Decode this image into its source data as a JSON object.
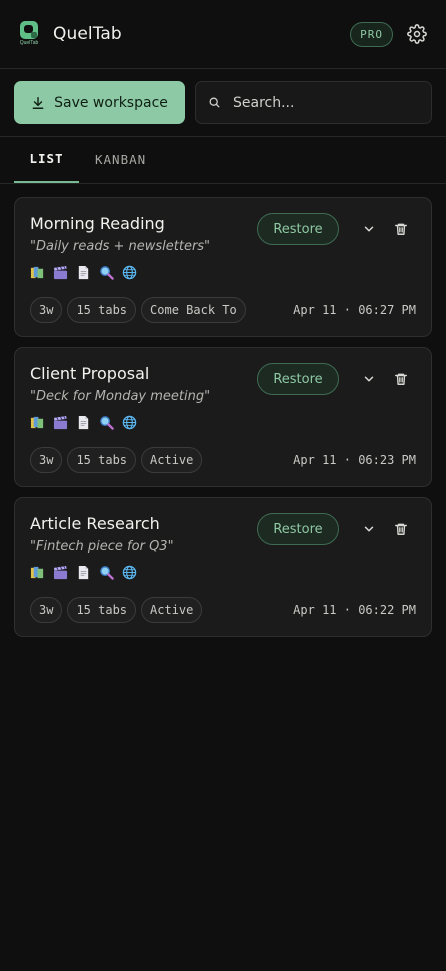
{
  "header": {
    "app_title": "QuelTab",
    "logo_text": "QuelTab",
    "pro_badge": "PRO",
    "settings_icon": "gear-icon"
  },
  "toolbar": {
    "save_label": "Save workspace",
    "search_placeholder": "Search...",
    "search_value": ""
  },
  "tabs": [
    {
      "label": "LIST",
      "active": true
    },
    {
      "label": "KANBAN",
      "active": false
    }
  ],
  "colors": {
    "accent": "#8cc9a4",
    "background": "#0f0f0f",
    "card": "#1a1b1a"
  },
  "workspaces": [
    {
      "title": "Morning Reading",
      "description": "\"Daily reads + newsletters\"",
      "age": "3w",
      "tabs_count": "15 tabs",
      "status": "Come Back To",
      "timestamp": "Apr 11 · 06:27 PM",
      "restore_label": "Restore"
    },
    {
      "title": "Client Proposal",
      "description": "\"Deck for Monday meeting\"",
      "age": "3w",
      "tabs_count": "15 tabs",
      "status": "Active",
      "timestamp": "Apr 11 · 06:23 PM",
      "restore_label": "Restore"
    },
    {
      "title": "Article Research",
      "description": "\"Fintech piece for Q3\"",
      "age": "3w",
      "tabs_count": "15 tabs",
      "status": "Active",
      "timestamp": "Apr 11 · 06:22 PM",
      "restore_label": "Restore"
    }
  ],
  "favicon_names": [
    "books-icon",
    "clapper-icon",
    "document-icon",
    "magnifier-icon",
    "globe-icon"
  ]
}
